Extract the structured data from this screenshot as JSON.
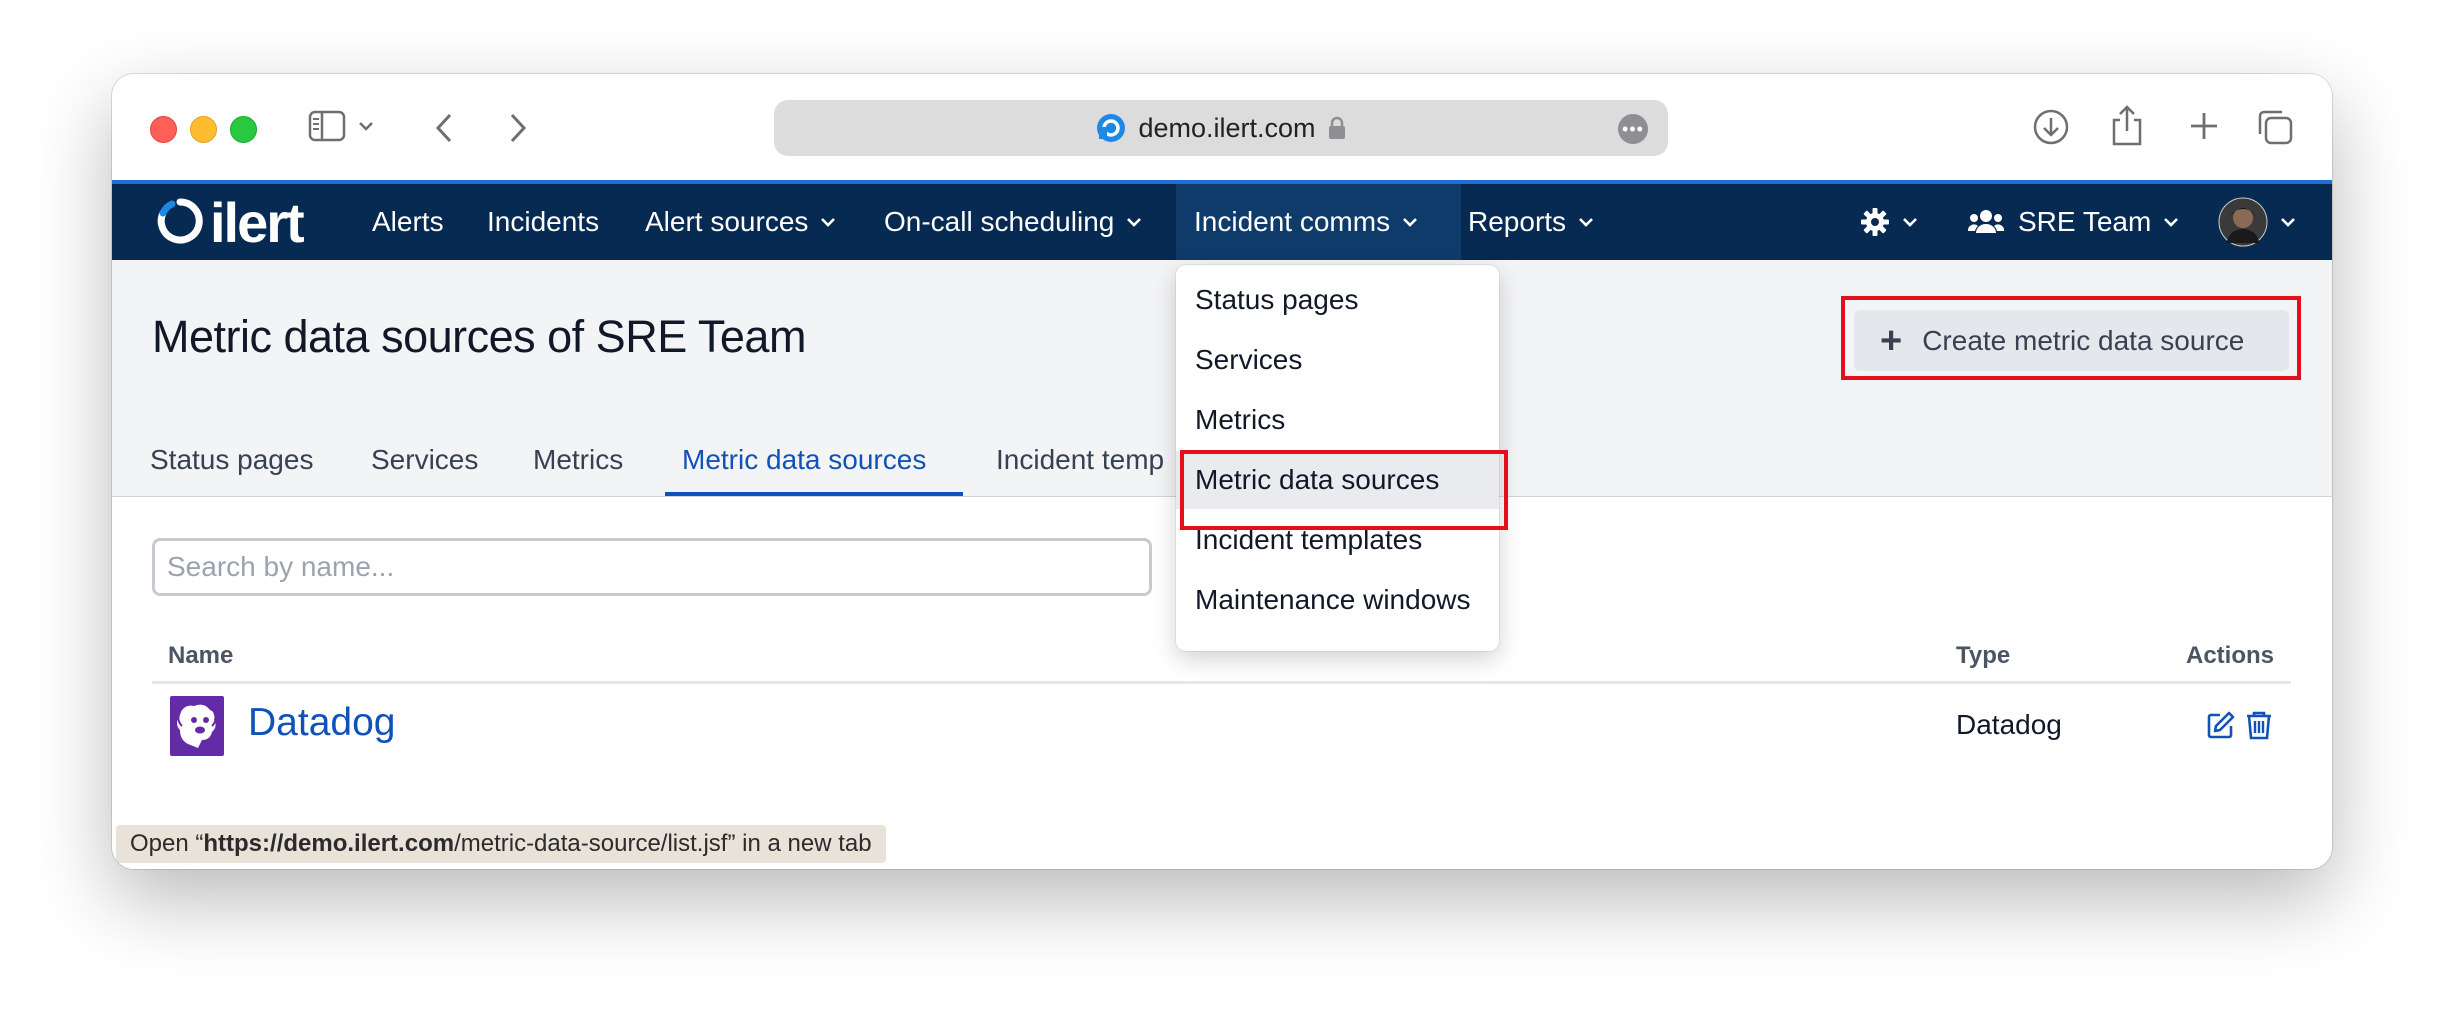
{
  "browser": {
    "url": "demo.ilert.com"
  },
  "nav": {
    "logo_text": "ilert",
    "items": [
      {
        "label": "Alerts"
      },
      {
        "label": "Incidents"
      },
      {
        "label": "Alert sources"
      },
      {
        "label": "On-call scheduling"
      },
      {
        "label": "Incident comms"
      },
      {
        "label": "Reports"
      }
    ],
    "team_label": "SRE Team"
  },
  "page": {
    "title": "Metric data sources of SRE Team",
    "create_button": "Create metric data source"
  },
  "tabs": [
    {
      "label": "Status pages"
    },
    {
      "label": "Services"
    },
    {
      "label": "Metrics"
    },
    {
      "label": "Metric data sources",
      "active": true
    },
    {
      "label": "Incident temp"
    }
  ],
  "search": {
    "placeholder": "Search by name...",
    "value": ""
  },
  "table": {
    "columns": {
      "name": "Name",
      "type": "Type",
      "actions": "Actions"
    },
    "rows": [
      {
        "name": "Datadog",
        "type": "Datadog",
        "icon": "datadog-icon"
      }
    ]
  },
  "dropdown": {
    "items": [
      {
        "label": "Status pages"
      },
      {
        "label": "Services"
      },
      {
        "label": "Metrics"
      },
      {
        "label": "Metric data sources",
        "highlighted": true
      },
      {
        "label": "Incident templates"
      },
      {
        "label": "Maintenance windows"
      }
    ]
  },
  "statusbar": {
    "prefix": "Open “",
    "host": "https://demo.ilert.com",
    "path": "/metric-data-source/list.jsf",
    "suffix": "” in a new tab"
  },
  "colors": {
    "nav_bg": "#062a51",
    "accent": "#1152b8",
    "highlight_box": "#e3101b",
    "datadog_purple": "#632ca6"
  }
}
